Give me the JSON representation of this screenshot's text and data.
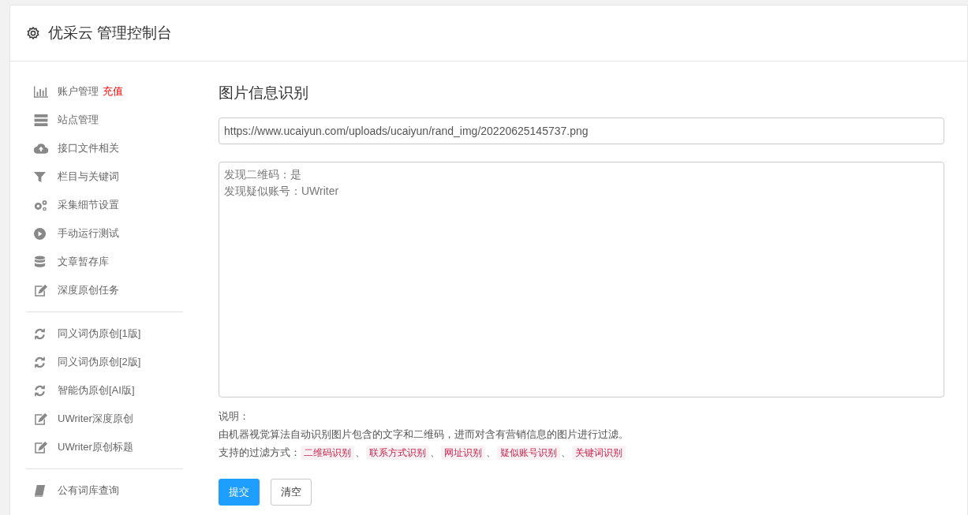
{
  "header": {
    "title": "优采云 管理控制台"
  },
  "sidebar": {
    "groups": [
      {
        "items": [
          {
            "kind": "chart",
            "label": "账户管理",
            "badge": "充值"
          },
          {
            "kind": "server",
            "label": "站点管理"
          },
          {
            "kind": "cloud",
            "label": "接口文件相关"
          },
          {
            "kind": "filter",
            "label": "栏目与关键词"
          },
          {
            "kind": "gears",
            "label": "采集细节设置"
          },
          {
            "kind": "play",
            "label": "手动运行测试"
          },
          {
            "kind": "database",
            "label": "文章暂存库"
          },
          {
            "kind": "edit",
            "label": "深度原创任务"
          }
        ]
      },
      {
        "items": [
          {
            "kind": "refresh",
            "label": "同义词伪原创[1版]"
          },
          {
            "kind": "refresh",
            "label": "同义词伪原创[2版]"
          },
          {
            "kind": "refresh",
            "label": "智能伪原创[AI版]"
          },
          {
            "kind": "edit",
            "label": "UWriter深度原创"
          },
          {
            "kind": "edit",
            "label": "UWriter原创标题"
          }
        ]
      },
      {
        "items": [
          {
            "kind": "book",
            "label": "公有词库查询"
          }
        ]
      }
    ]
  },
  "main": {
    "title": "图片信息识别",
    "url_field": {
      "value": "https://www.ucaiyun.com/uploads/ucaiyun/rand_img/20220625145737.png"
    },
    "result_box": {
      "lines": [
        "发现二维码：是",
        "发现疑似账号：UWriter"
      ]
    },
    "notes": {
      "heading": "说明：",
      "description": "由机器视觉算法自动识别图片包含的文字和二维码，进而对含有营销信息的图片进行过滤。",
      "filters_label": "支持的过滤方式：",
      "separator": "、",
      "filters": [
        "二维码识别",
        "联系方式识别",
        "网址识别",
        "疑似账号识别",
        "关键词识别"
      ]
    },
    "buttons": [
      {
        "kind": "primary",
        "label": "提交"
      },
      {
        "kind": "default",
        "label": "清空"
      }
    ]
  }
}
